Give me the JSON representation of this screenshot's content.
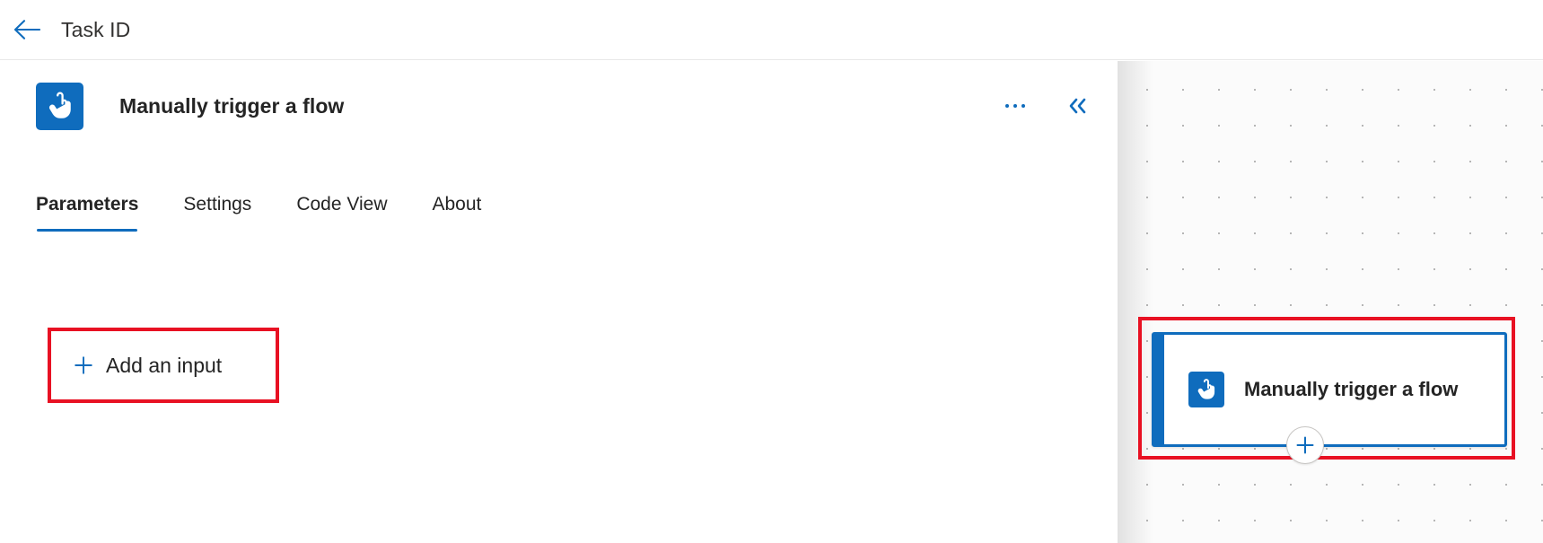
{
  "header": {
    "title": "Task ID",
    "back_icon": "arrow-left-icon",
    "accent_color": "#0f6cbd"
  },
  "panel": {
    "trigger_icon": "manual-trigger-hand-icon",
    "title": "Manually trigger a flow",
    "more_options_icon": "ellipsis-horizontal-icon",
    "collapse_icon": "chevron-double-left-icon",
    "tabs": [
      {
        "label": "Parameters",
        "active": true
      },
      {
        "label": "Settings",
        "active": false
      },
      {
        "label": "Code View",
        "active": false
      },
      {
        "label": "About",
        "active": false
      }
    ],
    "add_input": {
      "label": "Add an input",
      "plus_icon": "plus-icon",
      "annotation_color": "#e81123"
    }
  },
  "canvas": {
    "node": {
      "icon": "manual-trigger-hand-icon",
      "title": "Manually trigger a flow",
      "selected": true,
      "border_color": "#0f6cbd",
      "annotation_color": "#e81123"
    },
    "add_node_button_icon": "plus-circle-icon"
  }
}
